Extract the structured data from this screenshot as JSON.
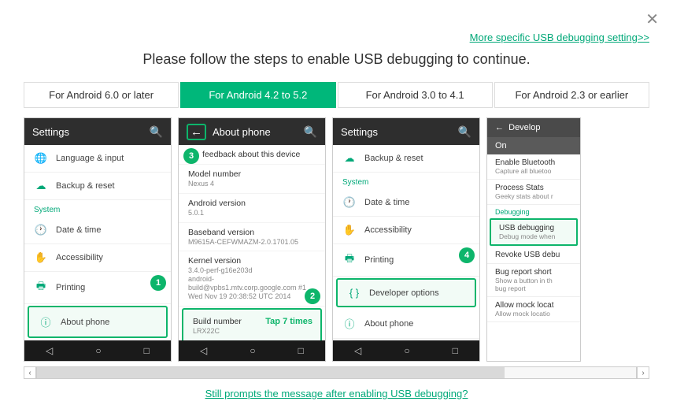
{
  "close_icon": "✕",
  "more_link": "More specific USB debugging setting>>",
  "title": "Please follow the steps to enable USB debugging to continue.",
  "tabs": [
    {
      "label": "For Android 6.0 or later",
      "active": false
    },
    {
      "label": "For Android 4.2 to 5.2",
      "active": true
    },
    {
      "label": "For Android 3.0 to 4.1",
      "active": false
    },
    {
      "label": "For Android 2.3 or earlier",
      "active": false
    }
  ],
  "phone1": {
    "header": "Settings",
    "rows": {
      "lang": "Language & input",
      "backup": "Backup & reset",
      "section": "System",
      "date": "Date & time",
      "access": "Accessibility",
      "print": "Printing",
      "about": "About phone"
    },
    "badge": "1"
  },
  "phone2": {
    "header": "About phone",
    "feedback": "feedback about this device",
    "model_t": "Model number",
    "model_v": "Nexus 4",
    "android_t": "Android version",
    "android_v": "5.0.1",
    "baseband_t": "Baseband version",
    "baseband_v": "M9615A-CEFWMAZM-2.0.1701.05",
    "kernel_t": "Kernel version",
    "kernel_v": "3.4.0-perf-g16e203d\nandroid-build@vpbs1.mtv.corp.google.com #1\nWed Nov 19 20:38:52 UTC 2014",
    "build_t": "Build number",
    "build_v": "LRX22C",
    "badge_back": "3",
    "badge_build": "2",
    "tap7": "Tap 7 times"
  },
  "phone3": {
    "header": "Settings",
    "backup": "Backup & reset",
    "section": "System",
    "date": "Date & time",
    "access": "Accessibility",
    "print": "Printing",
    "dev": "Developer options",
    "about": "About phone",
    "badge": "4"
  },
  "phone4": {
    "header": "Develop",
    "on": "On",
    "bt_t": "Enable Bluetooth",
    "bt_s": "Capture all bluetoo",
    "ps_t": "Process Stats",
    "ps_s": "Geeky stats about r",
    "sec": "Debugging",
    "usb_t": "USB debugging",
    "usb_s": "Debug mode when",
    "rev_t": "Revoke USB debu",
    "bug_t": "Bug report short",
    "bug_s": "Show a button in th\nbug report",
    "mock_t": "Allow mock locat",
    "mock_s": "Allow mock locatio"
  },
  "footer_link": "Still prompts the message after enabling USB debugging?"
}
